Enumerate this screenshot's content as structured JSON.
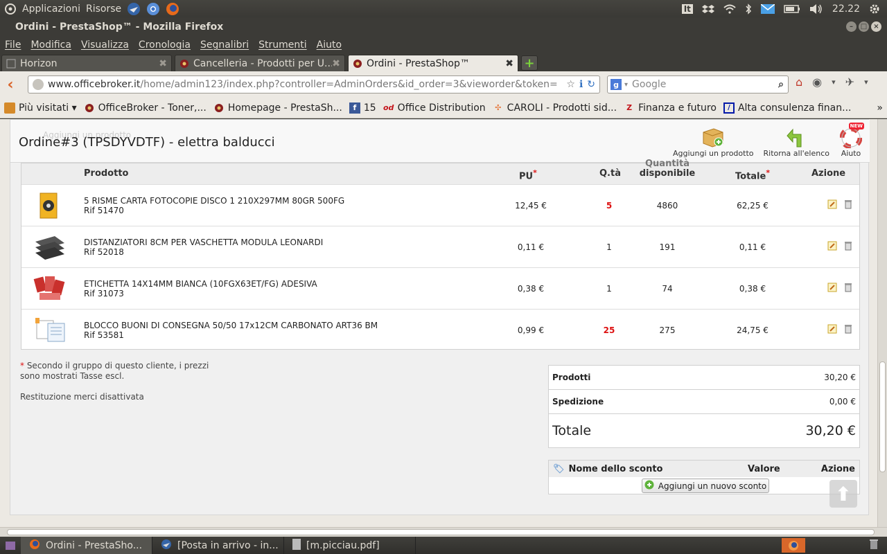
{
  "system": {
    "menu_apps": "Applicazioni",
    "menu_places": "Risorse",
    "keyboard_layout": "It",
    "clock": "22.22"
  },
  "window": {
    "title": "Ordini - PrestaShop™ - Mozilla Firefox"
  },
  "menubar": [
    "File",
    "Modifica",
    "Visualizza",
    "Cronologia",
    "Segnalibri",
    "Strumenti",
    "Aiuto"
  ],
  "tabs": [
    {
      "label": "Horizon"
    },
    {
      "label": "Cancelleria - Prodotti per U..."
    },
    {
      "label": "Ordini - PrestaShop™"
    }
  ],
  "navbar": {
    "url_domain": "www.officebroker.it",
    "url_path": "/home/admin123/index.php?controller=AdminOrders&id_order=3&vieworder&token=",
    "search_placeholder": "Google"
  },
  "bookmarks": [
    {
      "label": "Più visitati ▾",
      "icon": "folder-icon",
      "color": "#c1691a"
    },
    {
      "label": "OfficeBroker - Toner,...",
      "icon": "prestashop-icon",
      "color": "#8a1f1f"
    },
    {
      "label": "Homepage - PrestaSh...",
      "icon": "prestashop-icon",
      "color": "#8a1f1f"
    },
    {
      "label": "15",
      "icon": "facebook-icon",
      "color": "#3b5998"
    },
    {
      "label": "Office Distribution",
      "icon": "od-icon",
      "color": "#c4161c"
    },
    {
      "label": "CAROLI - Prodotti sid...",
      "icon": "joomla-icon",
      "color": "#5091cd"
    },
    {
      "label": "Finanza e futuro",
      "icon": "z-icon",
      "color": "#c4161c"
    },
    {
      "label": "Alta consulenza finan...",
      "icon": "db-icon",
      "color": "#0018a8"
    }
  ],
  "order": {
    "title": "Ordine#3 (TPSDYVDTF) - elettra balducci",
    "hidden_add_label": "Aggiungi un prodotto",
    "toolbar": {
      "add_product": "Aggiungi un prodotto",
      "back_to_list": "Ritorna all'elenco",
      "help": "Aiuto",
      "new_badge": "NEW"
    },
    "columns": {
      "product": "Prodotto",
      "unit_price": "PU",
      "qty": "Q.tà",
      "available_1": "Quantità",
      "available_2": "disponibile",
      "total": "Totale",
      "action": "Azione",
      "asterisk": "*"
    },
    "products": [
      {
        "name": "5 RISME CARTA FOTOCOPIE DISCO 1 210X297MM 80GR 500FG",
        "ref": "Rif 51470",
        "pu": "12,45 €",
        "qty": "5",
        "qty_highlight": true,
        "available": "4860",
        "total": "62,25 €",
        "thumb": "paper-ream-icon"
      },
      {
        "name": "DISTANZIATORI 8CM PER VASCHETTA MODULA LEONARDI",
        "ref": "Rif 52018",
        "pu": "0,11 €",
        "qty": "1",
        "qty_highlight": false,
        "available": "191",
        "total": "0,11 €",
        "thumb": "tray-icon"
      },
      {
        "name": "ETICHETTA 14X14MM BIANCA (10FGX63ET/FG) ADESIVA",
        "ref": "Rif 31073",
        "pu": "0,38 €",
        "qty": "1",
        "qty_highlight": false,
        "available": "74",
        "total": "0,38 €",
        "thumb": "labels-icon"
      },
      {
        "name": "BLOCCO BUONI DI CONSEGNA 50/50 17x12CM CARBONATO ART36 BM",
        "ref": "Rif 53581",
        "pu": "0,99 €",
        "qty": "25",
        "qty_highlight": true,
        "available": "275",
        "total": "24,75 €",
        "thumb": "form-pad-icon"
      }
    ],
    "notes": {
      "asterisk": "*",
      "tax_note": " Secondo il gruppo di questo cliente, i prezzi sono mostrati Tasse escl.",
      "returns": "Restituzione merci disattivata"
    },
    "totals": {
      "products_label": "Prodotti",
      "products_value": "30,20 €",
      "shipping_label": "Spedizione",
      "shipping_value": "0,00 €",
      "total_label": "Totale",
      "total_value": "30,20 €"
    },
    "discount": {
      "name_col": "Nome dello sconto",
      "value_col": "Valore",
      "action_col": "Azione",
      "add_button": "Aggiungi un nuovo sconto"
    }
  },
  "taskbar": [
    {
      "label": "Ordini - PrestaSho...",
      "icon": "firefox-icon",
      "active": true
    },
    {
      "label": "[Posta in arrivo - in...",
      "icon": "thunderbird-icon",
      "active": false
    },
    {
      "label": "[m.picciau.pdf]",
      "icon": "document-icon",
      "active": false
    }
  ],
  "colors": {
    "accent_red": "#dd1111",
    "ubuntu_panel": "#3c3b37",
    "firefox_orange": "#d9642a"
  }
}
